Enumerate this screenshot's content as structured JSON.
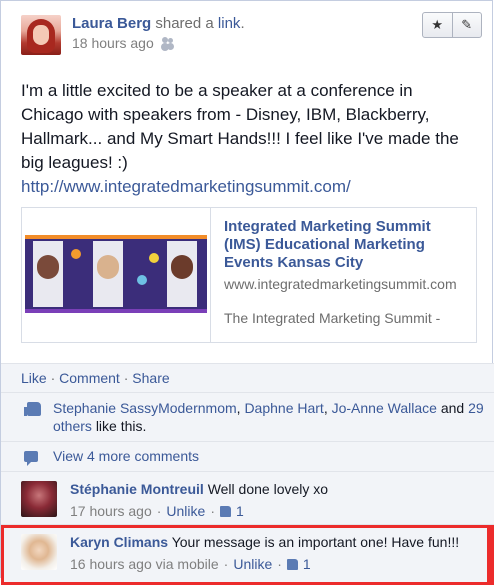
{
  "post": {
    "author": "Laura Berg",
    "shared_text": "shared a",
    "link_word": "link",
    "period": ".",
    "timestamp": "18 hours ago",
    "message": "I'm a little excited to be a speaker at a conference in Chicago with speakers from - Disney, IBM, Blackberry, Hallmark... and My Smart Hands!!! I feel like I've made the big leagues! :)",
    "url": "http://www.integratedmarketingsummit.com/",
    "star_label": "★",
    "edit_label": "✎"
  },
  "preview": {
    "title": "Integrated Marketing Summit (IMS) Educational Marketing Events Kansas City",
    "domain": "www.integratedmarketingsummit.com",
    "description": "The Integrated Marketing Summit -"
  },
  "ufi": {
    "like": "Like",
    "sep1": " · ",
    "comment": "Comment",
    "sep2": " · ",
    "share": "Share",
    "likers": [
      "Stephanie SassyModernmom",
      "Daphne Hart",
      "Jo-Anne Wallace"
    ],
    "likes_and": "and",
    "others": "29 others",
    "likes_suffix": "like this.",
    "view_more": "View 4 more comments"
  },
  "comments": [
    {
      "author": "Stéphanie Montreuil",
      "text": "Well done lovely xo",
      "time": "17 hours ago",
      "unlike": "Unlike",
      "likes": "1"
    },
    {
      "author": "Karyn Climans",
      "text": "Your message is an important one! Have fun!!!",
      "time": "16 hours ago via mobile",
      "unlike": "Unlike",
      "likes": "1"
    }
  ],
  "colors": {
    "link": "#3b5998",
    "highlight": "#ec2b2b"
  }
}
